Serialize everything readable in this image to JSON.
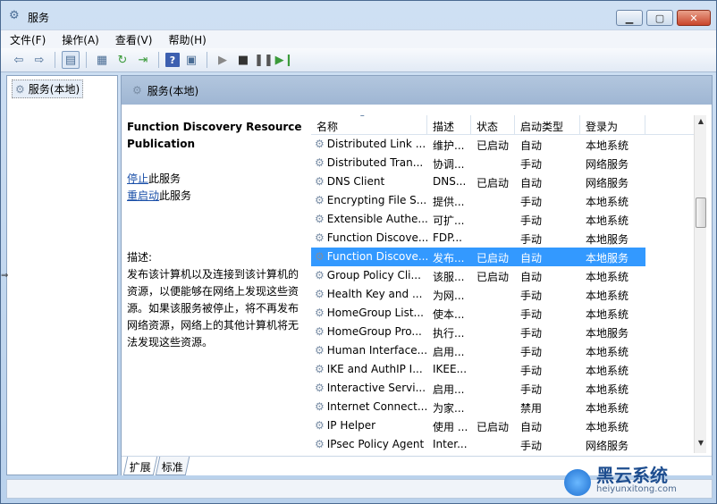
{
  "window": {
    "title": "服务"
  },
  "menu": [
    "文件(F)",
    "操作(A)",
    "查看(V)",
    "帮助(H)"
  ],
  "tree": {
    "root_label": "服务(本地)"
  },
  "pane_header": "服务(本地)",
  "description": {
    "service_title": "Function Discovery Resource Publication",
    "stop_link": "停止",
    "stop_suffix": "此服务",
    "restart_link": "重启动",
    "restart_suffix": "此服务",
    "label": "描述:",
    "text": "发布该计算机以及连接到该计算机的资源，以便能够在网络上发现这些资源。如果该服务被停止，将不再发布网络资源，网络上的其他计算机将无法发现这些资源。"
  },
  "columns": [
    "名称",
    "描述",
    "状态",
    "启动类型",
    "登录为"
  ],
  "rows": [
    [
      "Distributed Link ...",
      "维护...",
      "已启动",
      "自动",
      "本地系统"
    ],
    [
      "Distributed Tran...",
      "协调...",
      "",
      "手动",
      "网络服务"
    ],
    [
      "DNS Client",
      "DNS...",
      "已启动",
      "自动",
      "网络服务"
    ],
    [
      "Encrypting File S...",
      "提供...",
      "",
      "手动",
      "本地系统"
    ],
    [
      "Extensible Authe...",
      "可扩...",
      "",
      "手动",
      "本地系统"
    ],
    [
      "Function Discove...",
      "FDP...",
      "",
      "手动",
      "本地服务"
    ],
    [
      "Function Discove...",
      "发布...",
      "已启动",
      "自动",
      "本地服务"
    ],
    [
      "Group Policy Cli...",
      "该服...",
      "已启动",
      "自动",
      "本地系统"
    ],
    [
      "Health Key and ...",
      "为网...",
      "",
      "手动",
      "本地系统"
    ],
    [
      "HomeGroup List...",
      "使本...",
      "",
      "手动",
      "本地系统"
    ],
    [
      "HomeGroup Pro...",
      "执行...",
      "",
      "手动",
      "本地服务"
    ],
    [
      "Human Interface...",
      "启用...",
      "",
      "手动",
      "本地系统"
    ],
    [
      "IKE and AuthIP I...",
      "IKEE...",
      "",
      "手动",
      "本地系统"
    ],
    [
      "Interactive Servi...",
      "启用...",
      "",
      "手动",
      "本地系统"
    ],
    [
      "Internet Connect...",
      "为家...",
      "",
      "禁用",
      "本地系统"
    ],
    [
      "IP Helper",
      "使用 ...",
      "已启动",
      "自动",
      "本地系统"
    ],
    [
      "IPsec Policy Agent",
      "Inter...",
      "",
      "手动",
      "网络服务"
    ]
  ],
  "selected_row": 6,
  "tabs": [
    "扩展",
    "标准"
  ],
  "watermark": {
    "name": "黑云系统",
    "url": "heiyunxitong.com"
  }
}
